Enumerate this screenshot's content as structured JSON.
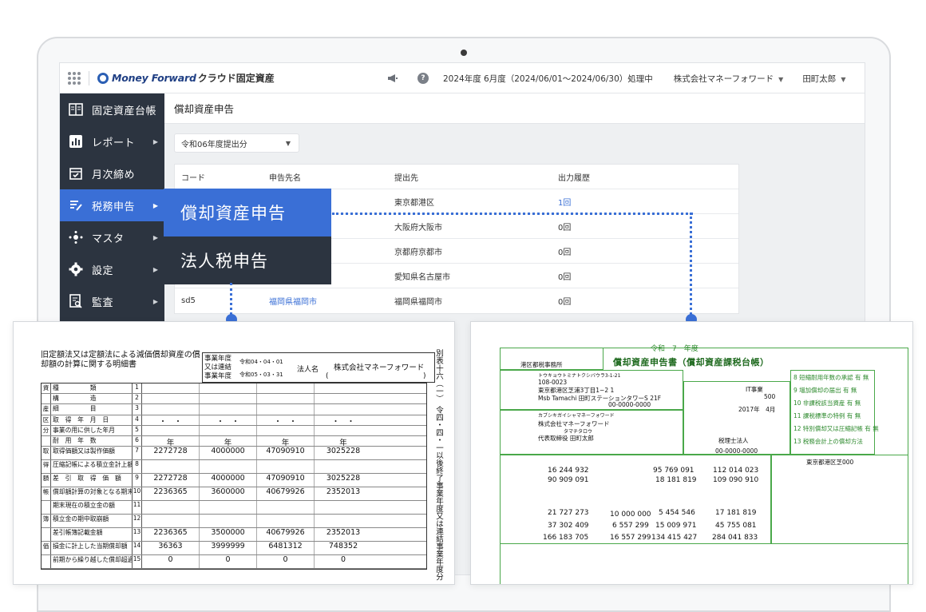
{
  "app": {
    "brand": "Money Forward",
    "product": "クラウド固定資産",
    "period": "2024年度 6月度（2024/06/01〜2024/06/30）処理中",
    "company": "株式会社マネーフォワード",
    "user": "田町太郎"
  },
  "sidebar": {
    "items": [
      {
        "label": "固定資産台帳",
        "icon": "ledger-icon"
      },
      {
        "label": "レポート",
        "icon": "report-icon"
      },
      {
        "label": "月次締め",
        "icon": "calendar-check-icon"
      },
      {
        "label": "税務申告",
        "icon": "tax-icon"
      },
      {
        "label": "マスタ",
        "icon": "master-icon"
      },
      {
        "label": "設定",
        "icon": "gear-icon"
      },
      {
        "label": "監査",
        "icon": "audit-icon"
      }
    ]
  },
  "page": {
    "title": "償却資産申告",
    "year_select": "令和06年度提出分"
  },
  "table": {
    "headers": [
      "コード",
      "申告先名",
      "提出先",
      "出力履歴"
    ],
    "rows": [
      {
        "code": "",
        "name": "",
        "dest": "東京都港区",
        "history": "1回"
      },
      {
        "code": "",
        "name": "",
        "dest": "大阪府大阪市",
        "history": "0回"
      },
      {
        "code": "",
        "name": "",
        "dest": "京都府京都市",
        "history": "0回"
      },
      {
        "code": "",
        "name": "",
        "dest": "愛知県名古屋市",
        "history": "0回"
      },
      {
        "code": "sd5",
        "name": "福岡県福岡市",
        "dest": "福岡県福岡市",
        "history": "0回"
      }
    ]
  },
  "flyout": {
    "items": [
      "償却資産申告",
      "法人税申告"
    ]
  },
  "doc_left": {
    "title": "旧定額法又は定額法による減価償却資産の償却額の計算に関する明細書",
    "period_label": "事業年度又は連結事業年度",
    "period_from": "令和04・04・01",
    "period_to": "令和05・03・31",
    "corp_label": "法人名",
    "corp_name": "株式会社マネーフォワード",
    "side_text": "別表十六（一）　令四・四・一以後終了事業年度又は連結事業年度分",
    "rows": [
      {
        "cat": "資",
        "label": "種　　　　　類",
        "no": "1",
        "vals": [
          "",
          "",
          "",
          ""
        ]
      },
      {
        "cat": "",
        "label": "構　　　　　造",
        "no": "2",
        "vals": [
          "",
          "",
          "",
          ""
        ]
      },
      {
        "cat": "産",
        "label": "細　　　　　目",
        "no": "3",
        "vals": [
          "",
          "",
          "",
          ""
        ]
      },
      {
        "cat": "区",
        "label": "取　得　年　月　日",
        "no": "4",
        "vals": [
          "・　・",
          "・　・",
          "・　・",
          "・　・"
        ]
      },
      {
        "cat": "分",
        "label": "事業の用に供した年月",
        "no": "5",
        "vals": [
          "",
          "",
          "",
          ""
        ]
      },
      {
        "cat": "",
        "label": "耐　用　年　数",
        "no": "6",
        "vals": [
          "年",
          "年",
          "年",
          "年"
        ]
      },
      {
        "cat": "取",
        "label": "取得価額又は製作価額",
        "no": "7",
        "vals": [
          "2272728",
          "4000000",
          "47090910",
          "3025228"
        ]
      },
      {
        "cat": "得",
        "label": "圧縮記帳による積立金計上額",
        "no": "8",
        "vals": [
          "",
          "",
          "",
          ""
        ]
      },
      {
        "cat": "額",
        "label": "差　引　取　得　価　額",
        "no": "9",
        "vals": [
          "2272728",
          "4000000",
          "47090910",
          "3025228"
        ]
      },
      {
        "cat": "帳",
        "label": "償却額計算の対象となる期末現在の帳簿記載金額",
        "no": "10",
        "vals": [
          "2236365",
          "3600000",
          "40679926",
          "2352013"
        ]
      },
      {
        "cat": "",
        "label": "期末現在の積立金の額",
        "no": "11",
        "vals": [
          "",
          "",
          "",
          ""
        ]
      },
      {
        "cat": "簿",
        "label": "積立金の期中取崩額",
        "no": "12",
        "vals": [
          "",
          "",
          "",
          ""
        ]
      },
      {
        "cat": "",
        "label": "差引帳簿記載金額",
        "no": "13",
        "vals": [
          "2236365",
          "3500000",
          "40679926",
          "2352013"
        ]
      },
      {
        "cat": "価",
        "label": "損金に計上した当期償却額",
        "no": "14",
        "vals": [
          "36363",
          "3999999",
          "6481312",
          "748352"
        ]
      },
      {
        "cat": "",
        "label": "前期から繰り越した償却超過額",
        "no": "15",
        "vals": [
          "0",
          "0",
          "0",
          "0"
        ]
      }
    ]
  },
  "doc_right": {
    "era": "令和　7　年度",
    "title": "償却資産申告書（償却資産課税台帳）",
    "addressee": "港区都税事務所",
    "address_kana": "トウキョウトミナトクシバウラ3-1-21",
    "postal": "108-0023",
    "address1": "東京都港区芝浦3丁目1−2 1",
    "address2": "Msb Tamachi 田町ステーションタワーS 21F",
    "phone": "00-0000-0000",
    "corp_kana": "カブシキガイシャマネーフォワード",
    "corp_name": "株式会社マネーフォワード",
    "rep_kana": "タマチタロウ",
    "rep": "代表取締役 田町太郎",
    "business": "IT事業",
    "capital": "500",
    "start": "2017年　4月",
    "accountant": "税理士法人",
    "accountant_phone": "00-0000-0000",
    "location": "東京都港区芝000",
    "nums": {
      "r1a": "16 244 932",
      "r1b": "95 769 091",
      "r1c": "112 014 023",
      "r2a": "90 909 091",
      "r2b": "18 181 819",
      "r2c": "109 090 910",
      "r5a": "21 727 273",
      "r5m": "10 000 000",
      "r5b": "5 454 546",
      "r5c": "17 181 819",
      "r6a": "37 302 409",
      "r6m": "6 557 299",
      "r6b": "15 009 971",
      "r6c": "45 755 081",
      "r8a": "166 183 705",
      "r8m": "16 557 299",
      "r8b": "134 415 427",
      "r8c": "284 041 833"
    }
  },
  "colors": {
    "sidebar_bg": "#2c3440",
    "accent": "#3a6fd6",
    "form_green": "#2d8a2d"
  }
}
